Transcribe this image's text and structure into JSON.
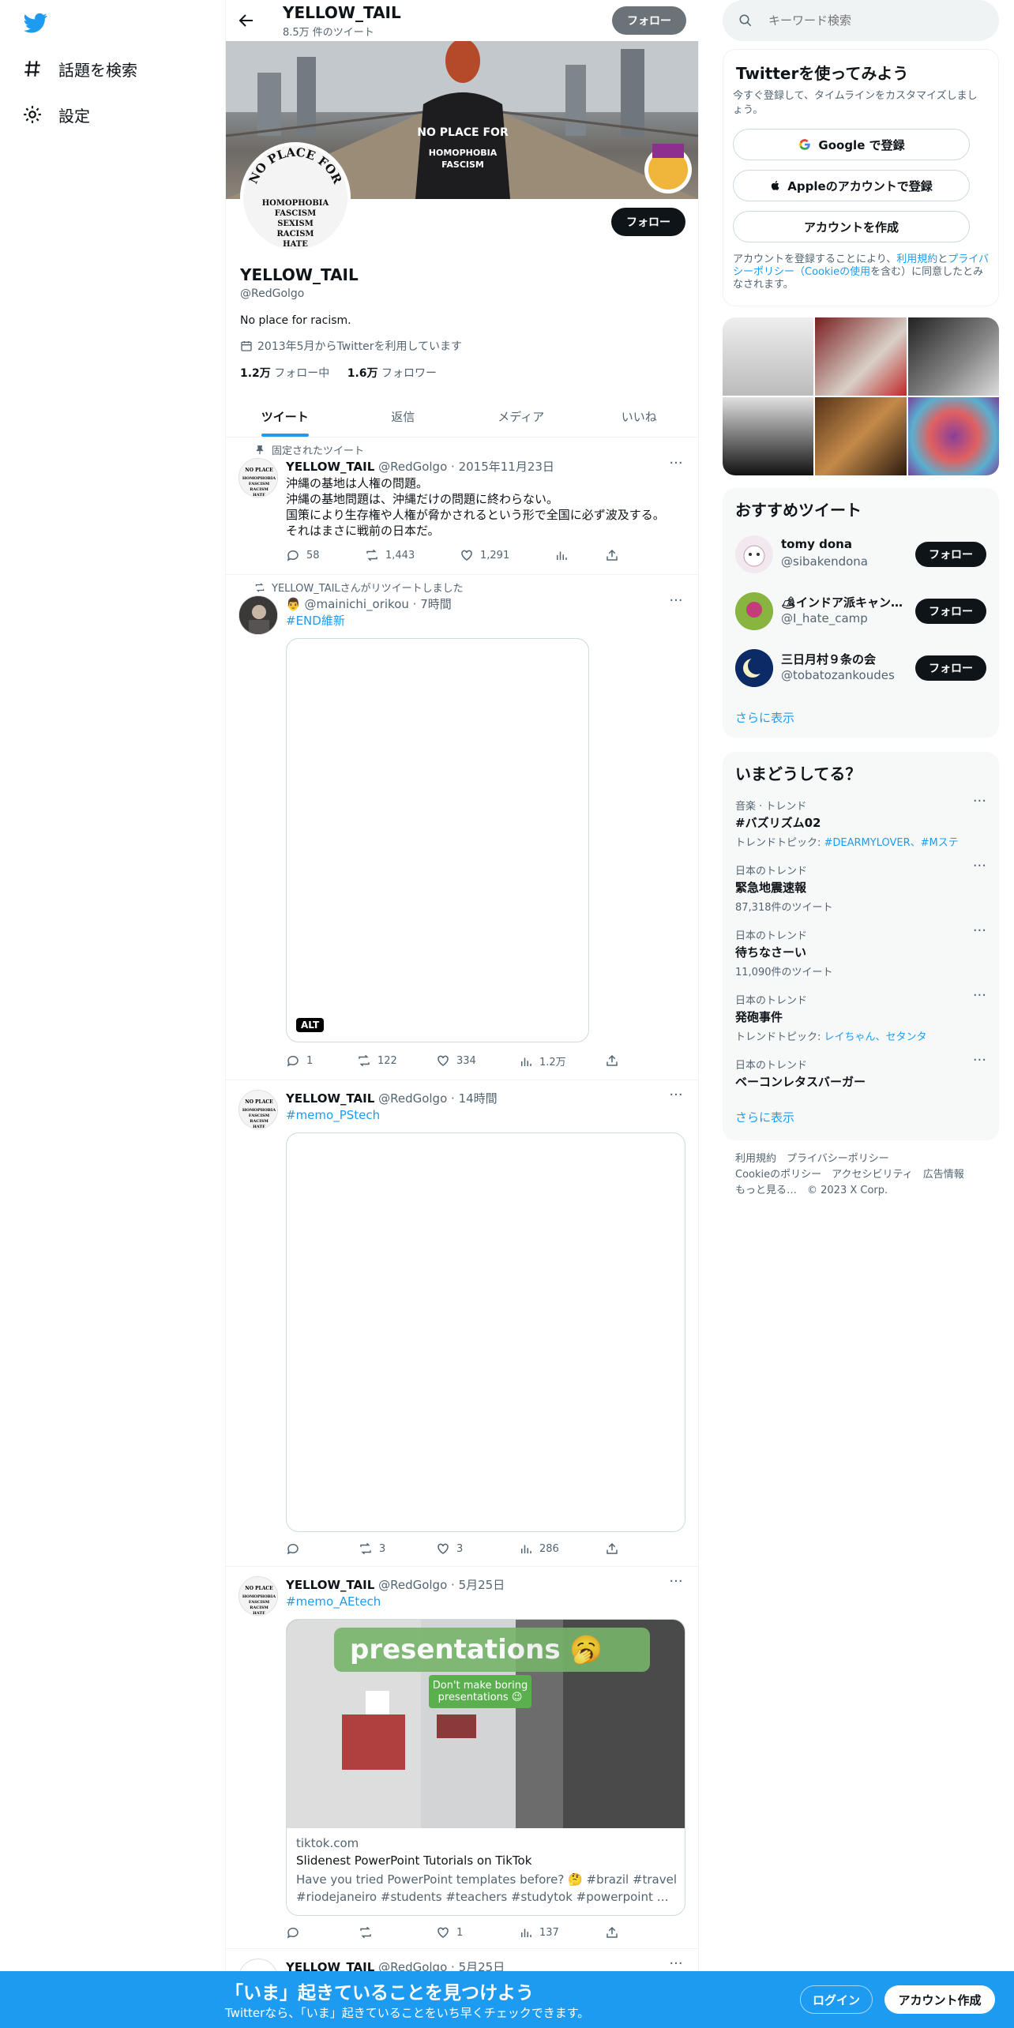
{
  "nav": {
    "explore_label": "話題を検索",
    "settings_label": "設定"
  },
  "profile": {
    "header_name": "YELLOW_TAIL",
    "header_count": "8.5万 件のツイート",
    "name": "YELLOW_TAIL",
    "handle": "@RedGolgo",
    "bio": "No place for racism.",
    "joined": "2013年5月からTwitterを利用しています",
    "following_count": "1.2万",
    "following_label": "フォロー中",
    "followers_count": "1.6万",
    "followers_label": "フォロワー",
    "follow_label": "フォロー",
    "avatar_text": [
      "NO PLACE FOR",
      "HOMOPHOBIA",
      "FASCISM",
      "SEXISM",
      "RACISM",
      "HATE"
    ]
  },
  "tabs": [
    "ツイート",
    "返信",
    "メディア",
    "いいね"
  ],
  "tweets": [
    {
      "context": "固定されたツイート",
      "name": "YELLOW_TAIL",
      "handle": "@RedGolgo",
      "time": "2015年11月23日",
      "text_lines": [
        "沖縄の基地は人権の問題。",
        "沖縄の基地問題は、沖縄だけの問題に終わらない。",
        "国策により生存権や人権が脅かされるという形で全国に必ず波及する。",
        "それはまさに戦前の日本だ。"
      ],
      "replies": "58",
      "retweets": "1,443",
      "likes": "1,291"
    },
    {
      "context": "YELLOW_TAILさんがリツイートしました",
      "name": "👨",
      "handle": "@mainichi_orikou",
      "time": "7時間",
      "hashtag": "#END維新",
      "alt_label": "ALT",
      "replies": "1",
      "retweets": "122",
      "likes": "334",
      "views": "1.2万"
    },
    {
      "name": "YELLOW_TAIL",
      "handle": "@RedGolgo",
      "time": "14時間",
      "hashtag": "#memo_PStech",
      "retweets": "3",
      "likes": "3",
      "views": "286"
    },
    {
      "name": "YELLOW_TAIL",
      "handle": "@RedGolgo",
      "time": "5月25日",
      "hashtag": "#memo_AEtech",
      "card_overlay_big": "presentations 🥱",
      "card_overlay_small": "Don't make boring presentations 😉",
      "card_domain": "tiktok.com",
      "card_title": "Slidenest PowerPoint Tutorials on TikTok",
      "card_desc1": "Have you tried PowerPoint templates before? 🤔 #brazil #travel",
      "card_desc2": "#riodejaneiro #students #teachers #studytok #powerpoint #presentation...",
      "likes": "1",
      "views": "137"
    },
    {
      "name": "YELLOW_TAIL",
      "handle": "@RedGolgo",
      "time": "5月25日"
    }
  ],
  "search": {
    "placeholder": "キーワード検索"
  },
  "signup": {
    "title": "Twitterを使ってみよう",
    "subtitle": "今すぐ登録して、タイムラインをカスタマイズしましょう。",
    "google": "Google で登録",
    "apple": "Appleのアカウントで登録",
    "create": "アカウントを作成",
    "terms_prefix": "アカウントを登録することにより、",
    "terms_link": "利用規約",
    "terms_mid": "と",
    "privacy_link": "プライバシーポリシー",
    "cookie_link": "（Cookieの使用",
    "terms_suffix": "を含む）に同意したとみなされます。"
  },
  "recommended": {
    "title": "おすすめツイート",
    "users": [
      {
        "name": "tomy dona",
        "handle": "@sibakendona"
      },
      {
        "name": "🏕インドア派キャンパー",
        "handle": "@I_hate_camp"
      },
      {
        "name": "三日月村９条の会",
        "handle": "@tobatozankoudes"
      }
    ],
    "more": "さらに表示"
  },
  "trends": {
    "title": "いまどうしてる？",
    "items": [
      {
        "meta": "音楽 · トレンド",
        "name": "#バズリズム02",
        "sub_label": "トレンドトピック: ",
        "sub": "#DEARMYLOVER、#Mステ"
      },
      {
        "meta": "日本のトレンド",
        "name": "緊急地震速報",
        "sub_plain": "87,318件のツイート"
      },
      {
        "meta": "日本のトレンド",
        "name": "待ちなさーい",
        "sub_plain": "11,090件のツイート"
      },
      {
        "meta": "日本のトレンド",
        "name": "発砲事件",
        "sub_label": "トレンドトピック: ",
        "sub": "レイちゃん、セタンタ"
      },
      {
        "meta": "日本のトレンド",
        "name": "ベーコンレタスバーガー"
      }
    ],
    "more": "さらに表示"
  },
  "footer": {
    "line1": "利用規約　プライバシーポリシー",
    "line2": "Cookieのポリシー　アクセシビリティ　広告情報",
    "line3": "もっと見る…　© 2023 X Corp."
  },
  "bottom": {
    "title": "「いま」起きていることを見つけよう",
    "subtitle": "Twitterなら、「いま」起きていることをいち早くチェックできます。",
    "login": "ログイン",
    "register": "アカウント作成"
  },
  "colors": {
    "accent": "#1d9bf0",
    "text": "#0f1419",
    "muted": "#536471"
  }
}
